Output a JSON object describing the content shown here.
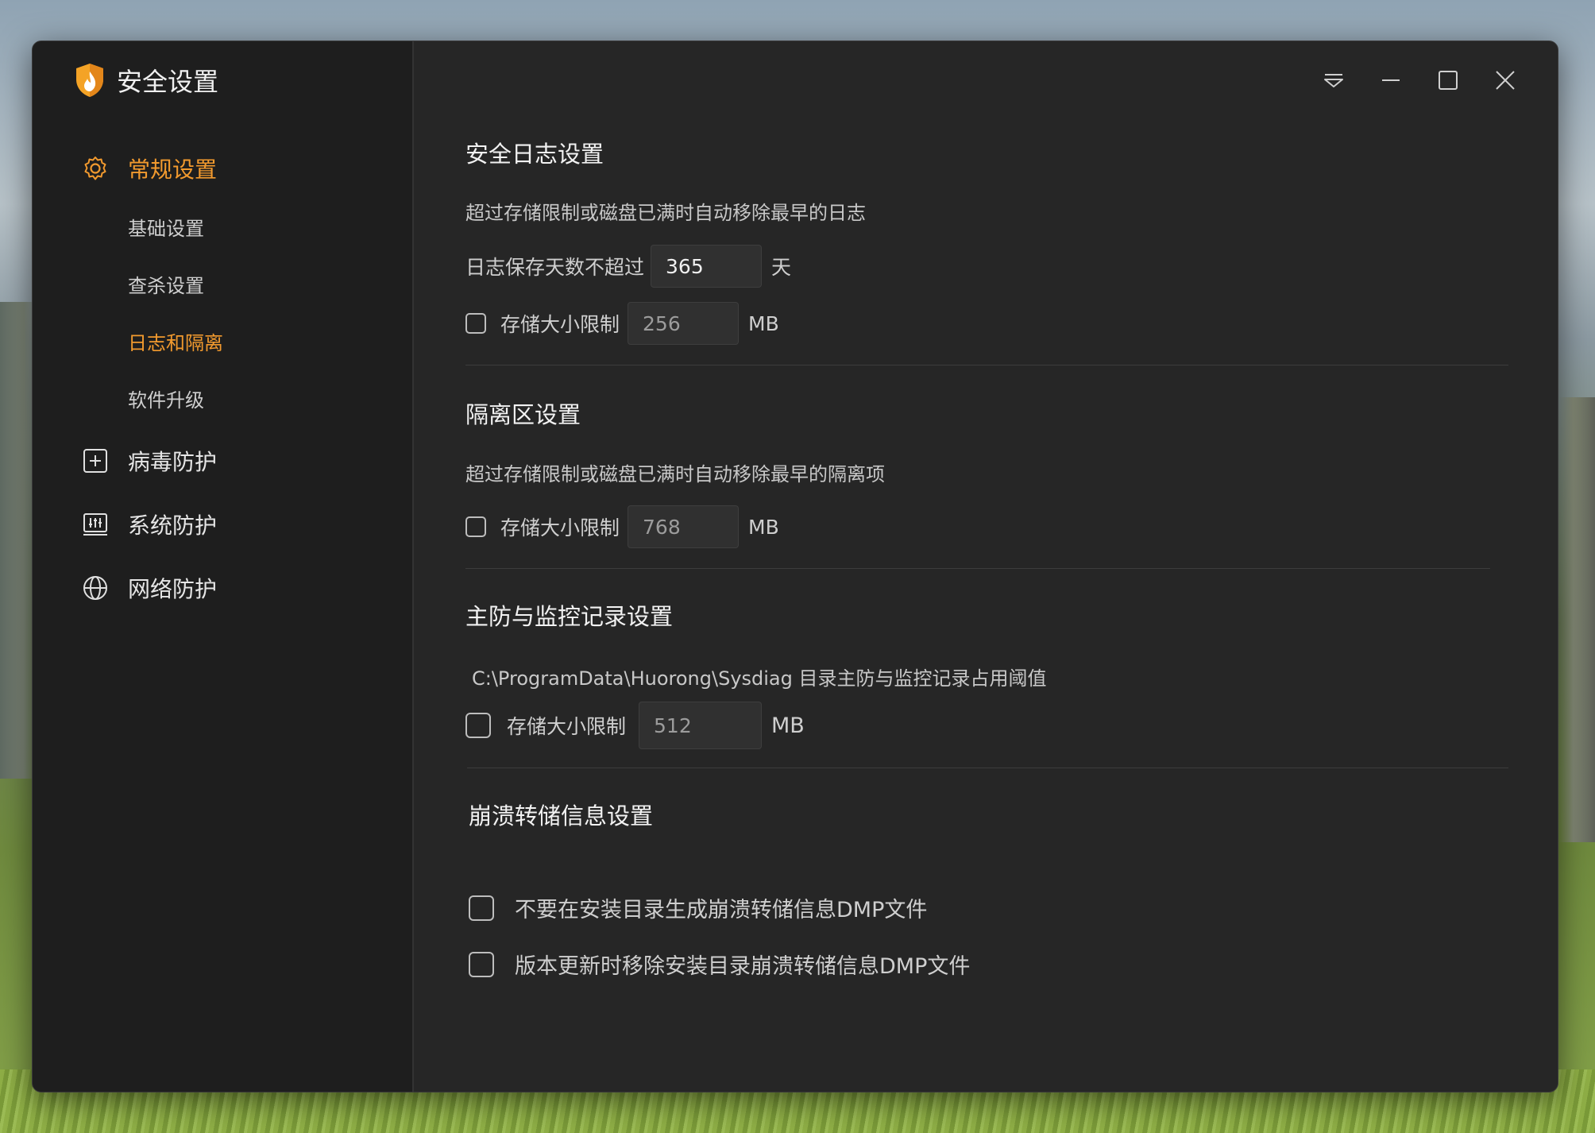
{
  "app": {
    "title": "安全设置"
  },
  "sidebar": {
    "general": {
      "label": "常规设置",
      "items": [
        {
          "label": "基础设置"
        },
        {
          "label": "查杀设置"
        },
        {
          "label": "日志和隔离"
        },
        {
          "label": "软件升级"
        }
      ]
    },
    "virus": {
      "label": "病毒防护"
    },
    "system": {
      "label": "系统防护"
    },
    "network": {
      "label": "网络防护"
    }
  },
  "sections": {
    "log": {
      "title": "安全日志设置",
      "desc": "超过存储限制或磁盘已满时自动移除最早的日志",
      "days_label": "日志保存天数不超过",
      "days_value": "365",
      "days_unit": "天",
      "size_label": "存储大小限制",
      "size_value": "256",
      "size_unit": "MB",
      "size_checked": false
    },
    "quarantine": {
      "title": "隔离区设置",
      "desc": "超过存储限制或磁盘已满时自动移除最早的隔离项",
      "size_label": "存储大小限制",
      "size_value": "768",
      "size_unit": "MB",
      "size_checked": false
    },
    "monitor": {
      "title": "主防与监控记录设置",
      "desc": "C:\\ProgramData\\Huorong\\Sysdiag 目录主防与监控记录占用阈值",
      "size_label": "存储大小限制",
      "size_value": "512",
      "size_unit": "MB",
      "size_checked": false
    },
    "crash": {
      "title": "崩溃转储信息设置",
      "option1": "不要在安装目录生成崩溃转储信息DMP文件",
      "option2": "版本更新时移除安装目录崩溃转储信息DMP文件",
      "option1_checked": false,
      "option2_checked": false
    }
  },
  "colors": {
    "accent": "#f29a2e",
    "background": "#262626",
    "sidebar": "#1e1e1e"
  },
  "icons": {
    "logo": "shield-flame-icon",
    "general": "gear-icon",
    "virus": "plus-square-icon",
    "system": "sliders-monitor-icon",
    "network": "globe-icon",
    "menu": "dropdown-menu-icon",
    "minimize": "minimize-icon",
    "maximize": "maximize-icon",
    "close": "close-icon"
  }
}
